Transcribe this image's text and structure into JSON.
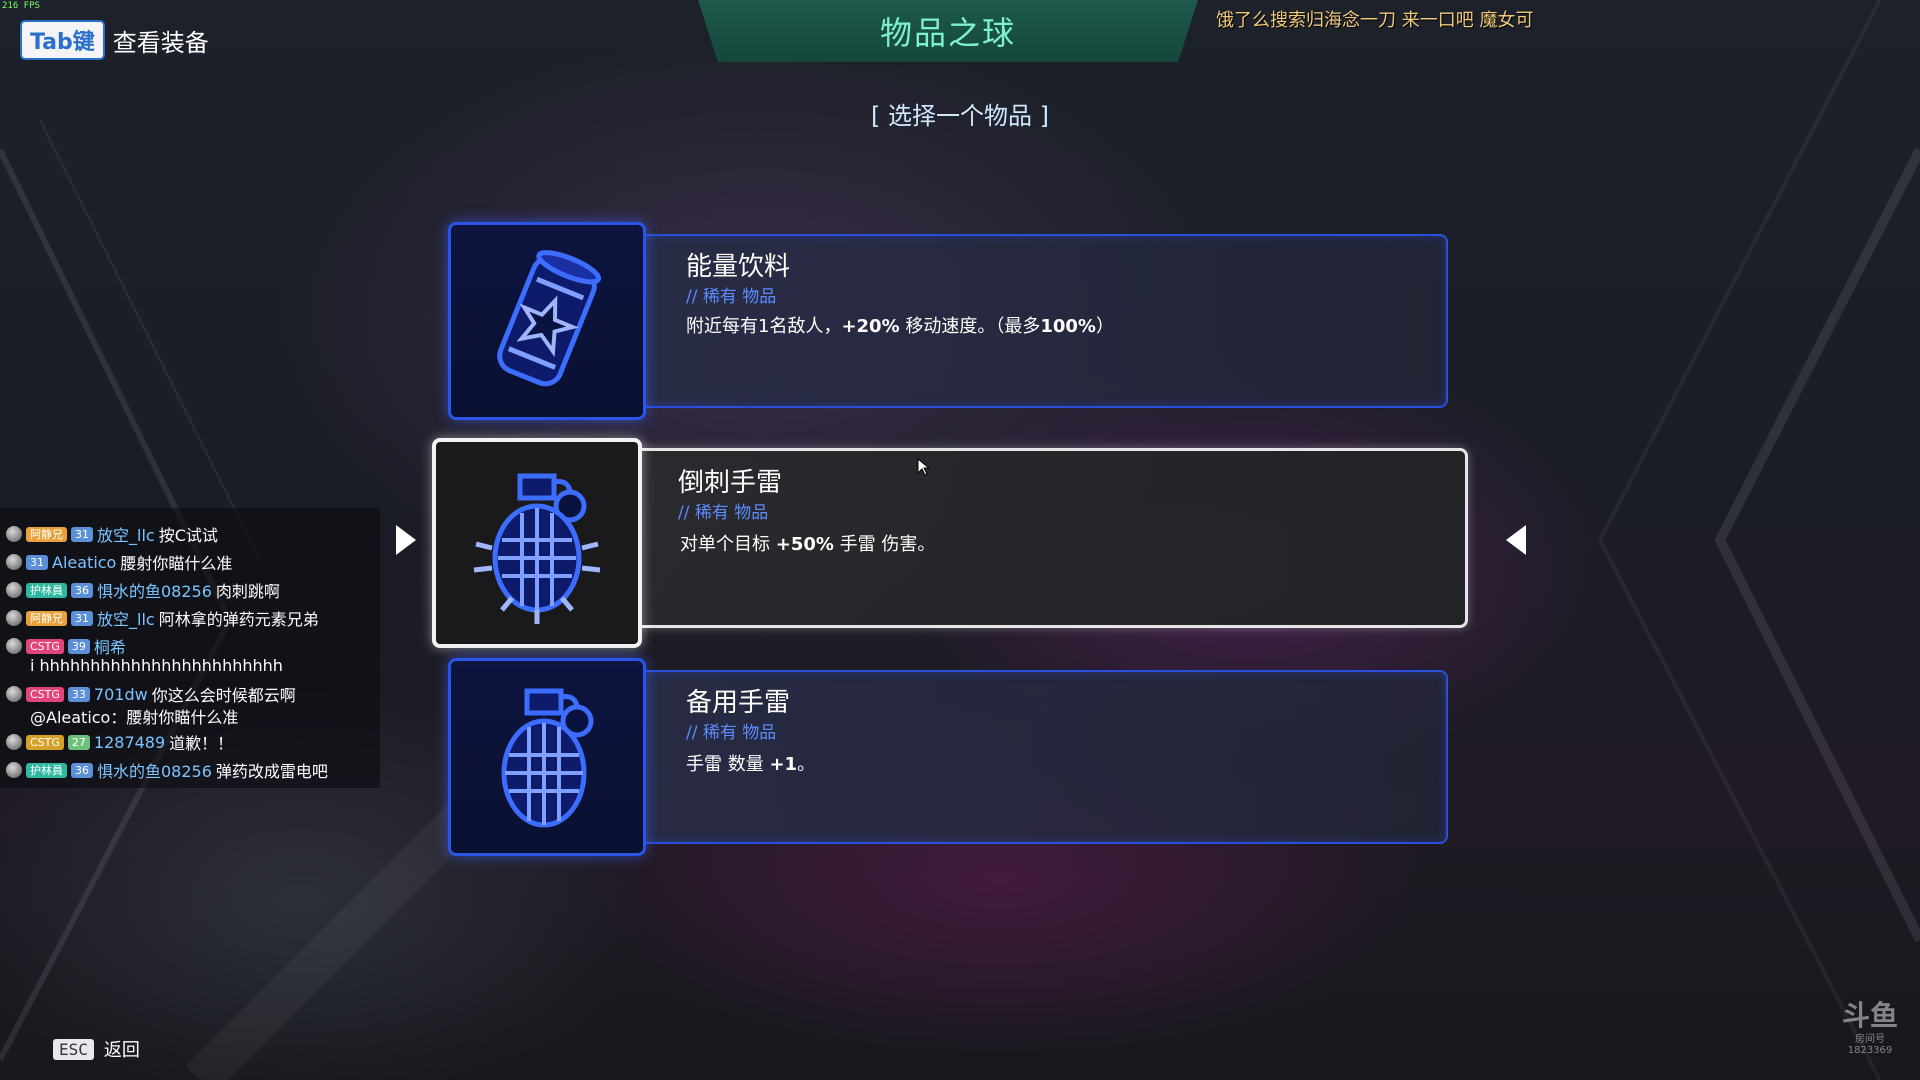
{
  "overlay": {
    "fps": "216 FPS",
    "marquee": "饿了么搜索归海念一刀 来一口吧 魔女可",
    "watermark_logo": "斗鱼",
    "watermark_sub": "房间号",
    "watermark_room": "1823369"
  },
  "header": {
    "tab_key": "Tab键",
    "tab_label": "查看装备",
    "title": "物品之球",
    "subtitle": "[ 选择一个物品 ]"
  },
  "items": [
    {
      "name": "能量饮料",
      "rarity": "// 稀有 物品",
      "icon": "energy-drink-icon",
      "desc_a": "附近每有1名敌人，",
      "desc_b": "+20%",
      "desc_c": " 移动速度。（最多",
      "desc_d": "100%",
      "desc_e": "）",
      "selected": false
    },
    {
      "name": "倒刺手雷",
      "rarity": "// 稀有 物品",
      "icon": "spiked-grenade-icon",
      "desc_a": "对单个目标 ",
      "desc_b": "+50%",
      "desc_c": " 手雷 伤害。",
      "selected": true
    },
    {
      "name": "备用手雷",
      "rarity": "// 稀有 物品",
      "icon": "grenade-icon",
      "desc_a": "手雷 数量 ",
      "desc_b": "+1",
      "desc_c": "。",
      "selected": false
    }
  ],
  "chat": [
    {
      "fan": "阿静兄",
      "level": "31",
      "user": "放空_llc",
      "text": "按C试试"
    },
    {
      "level": "31",
      "user": "Aleatico",
      "text": "腰射你瞄什么准"
    },
    {
      "fan": "护林員",
      "level": "36",
      "user": "惧水的鱼08256",
      "text": "肉刺跳啊"
    },
    {
      "fan": "阿静兄",
      "level": "31",
      "user": "放空_llc",
      "text": "阿林拿的弹药元素兄弟"
    },
    {
      "fan": "CSTG",
      "level": "39",
      "user": "桐希",
      "text": "i hhhhhhhhhhhhhhhhhhhhhhhh"
    },
    {
      "fan": "CSTG",
      "level": "33",
      "user": "701dw",
      "text": "你这么会时候都云啊",
      "text2": "@Aleatico：腰射你瞄什么准"
    },
    {
      "fan": "CSTG",
      "level": "27",
      "user": "1287489",
      "text": "道歉！！"
    },
    {
      "fan": "护林員",
      "level": "36",
      "user": "惧水的鱼08256",
      "text": "弹药改成雷电吧"
    }
  ],
  "footer": {
    "esc_key": "ESC",
    "back_label": "返回"
  },
  "colors": {
    "accent_blue": "#2a55e6",
    "rarity_blue": "#5b8cff",
    "title_green": "#7ff0d0",
    "selected_border": "#e6e6e6"
  }
}
